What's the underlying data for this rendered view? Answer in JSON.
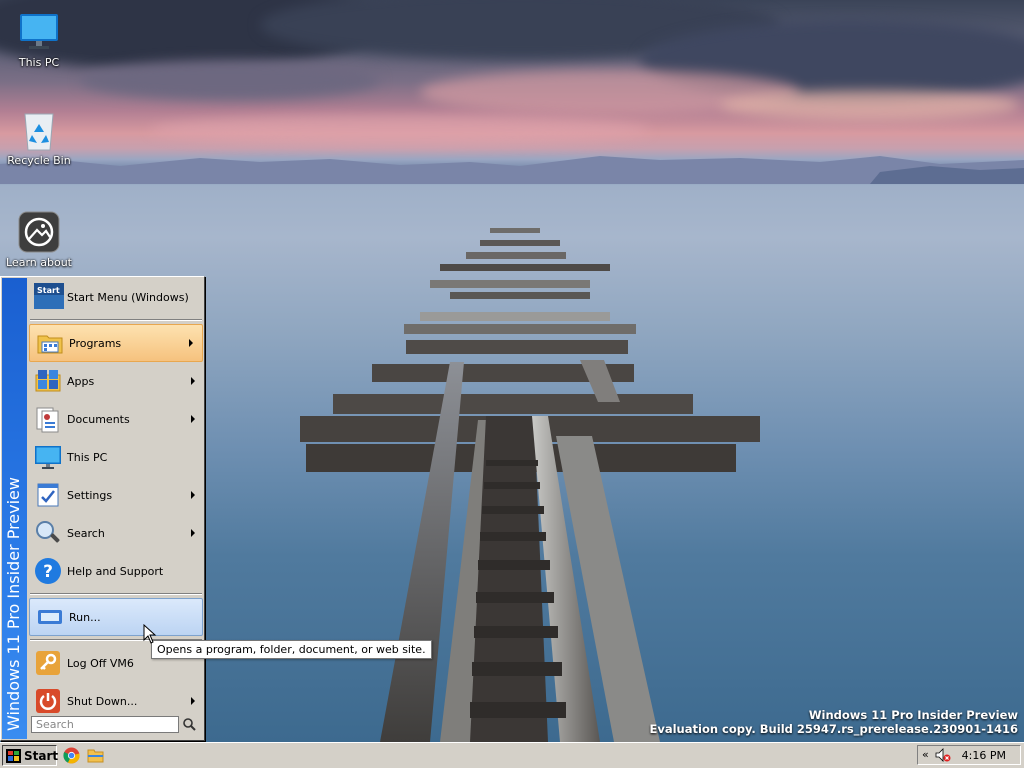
{
  "desktop": {
    "icons": [
      {
        "name": "this-pc",
        "label": "This PC"
      },
      {
        "name": "recycle-bin",
        "label": "Recycle Bin"
      },
      {
        "name": "learn-about",
        "label": "Learn about"
      }
    ],
    "watermark": {
      "line1": "Windows 11 Pro Insider Preview",
      "line2": "Evaluation copy. Build 25947.rs_prerelease.230901-1416"
    }
  },
  "start_menu": {
    "sidebar_text": "Windows 11 Pro Insider Preview",
    "header_label": "Start Menu (Windows)",
    "header_icon_text": "Start",
    "items": [
      {
        "label": "Programs",
        "icon": "programs-folder-icon",
        "submenu": true
      },
      {
        "label": "Apps",
        "icon": "apps-icon",
        "submenu": true
      },
      {
        "label": "Documents",
        "icon": "documents-icon",
        "submenu": true
      },
      {
        "label": "This PC",
        "icon": "monitor-icon",
        "submenu": false
      },
      {
        "label": "Settings",
        "icon": "settings-icon",
        "submenu": true
      },
      {
        "label": "Search",
        "icon": "magnifier-icon",
        "submenu": true
      },
      {
        "label": "Help and Support",
        "icon": "help-icon",
        "submenu": false
      },
      {
        "label": "Run...",
        "icon": "run-icon",
        "submenu": false
      },
      {
        "label": "Log Off VM6",
        "icon": "key-icon",
        "submenu": false
      },
      {
        "label": "Shut Down...",
        "icon": "power-icon",
        "submenu": true
      }
    ],
    "search_placeholder": "Search"
  },
  "tooltip": "Opens a program, folder, document, or web site.",
  "taskbar": {
    "start_label": "Start",
    "pinned": [
      {
        "name": "chrome-icon"
      },
      {
        "name": "file-explorer-icon"
      }
    ],
    "tray_chevron": "«",
    "clock": "4:16 PM"
  },
  "colors": {
    "sidebar": "#2a7be8",
    "hover": "#f6c27e",
    "selected": "#bcd4f3",
    "face": "#d4d0c8"
  }
}
